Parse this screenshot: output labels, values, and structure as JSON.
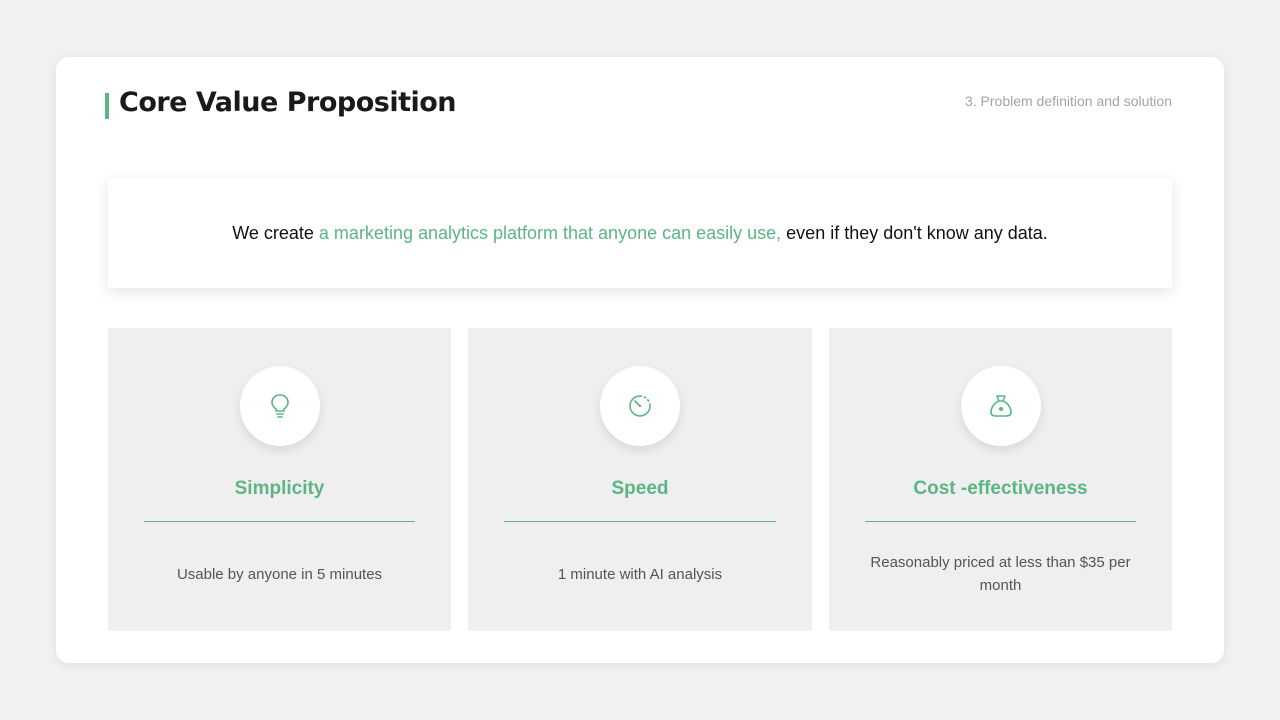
{
  "header": {
    "title": "Core Value Proposition",
    "section_label": "3. Problem definition and solution"
  },
  "statement": {
    "prefix": "We create ",
    "highlight": "a marketing analytics platform that anyone can easily use,",
    "suffix": " even if they don't know any data."
  },
  "features": [
    {
      "icon": "lightbulb-icon",
      "title": "Simplicity",
      "description": "Usable by anyone in 5 minutes"
    },
    {
      "icon": "stopwatch-icon",
      "title": "Speed",
      "description": "1 minute with AI analysis"
    },
    {
      "icon": "money-bag-icon",
      "title": "Cost -effectiveness",
      "description": "Reasonably priced at less than $35 per month"
    }
  ],
  "colors": {
    "accent": "#5cb584",
    "card_background": "#efefef",
    "page_background": "#f1f1f1"
  }
}
